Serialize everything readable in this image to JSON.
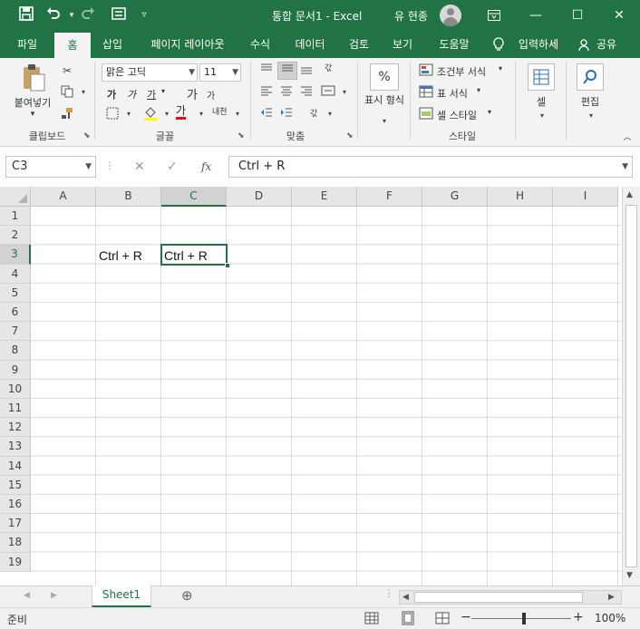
{
  "titlebar": {
    "title": "통합 문서1  -  Excel",
    "user": "유 현종",
    "icons": [
      "save-icon",
      "undo-icon",
      "redo-icon",
      "form-icon",
      "customize-icon"
    ],
    "ribbon_display_icon": "ribbon-display-icon",
    "minimize": "—",
    "maximize": "☐",
    "close": "✕"
  },
  "tabs": [
    "파일",
    "홈",
    "삽입",
    "페이지 레이아웃",
    "수식",
    "데이터",
    "검토",
    "보기",
    "도움말"
  ],
  "active_tab": "홈",
  "tell_me": "입력하세",
  "share": "공유",
  "ribbon": {
    "clipboard": {
      "paste": "붙여넣기",
      "label": "클립보드"
    },
    "font": {
      "name": "맑은 고딕",
      "size": "11",
      "label": "글꼴",
      "bold": "가",
      "italic": "가",
      "underline": "가",
      "grow": "가",
      "shrink": "가",
      "color": "가",
      "phonetic": "내천"
    },
    "alignment": {
      "label": "맞춤"
    },
    "number": {
      "format": "표시 형식",
      "symbol": "%"
    },
    "styles": {
      "conditional": "조건부 서식",
      "table": "표 서식",
      "cell_styles": "셀 스타일",
      "label": "스타일"
    },
    "cells": {
      "label": "셀"
    },
    "editing": {
      "label": "편집"
    }
  },
  "formula_bar": {
    "name_box": "C3",
    "fx": "fx",
    "value": "Ctrl + R"
  },
  "grid": {
    "columns": [
      "A",
      "B",
      "C",
      "D",
      "E",
      "F",
      "G",
      "H",
      "I"
    ],
    "selected_column": "C",
    "rows": [
      "1",
      "2",
      "3",
      "4",
      "5",
      "6",
      "7",
      "8",
      "9",
      "10",
      "11",
      "12",
      "13",
      "14",
      "15",
      "16",
      "17",
      "18",
      "19"
    ],
    "selected_row": "3",
    "cells": {
      "B3": "Ctrl + R",
      "C3": "Ctrl + R"
    }
  },
  "sheets": [
    "Sheet1"
  ],
  "status": {
    "mode": "준비",
    "zoom": "100%"
  }
}
